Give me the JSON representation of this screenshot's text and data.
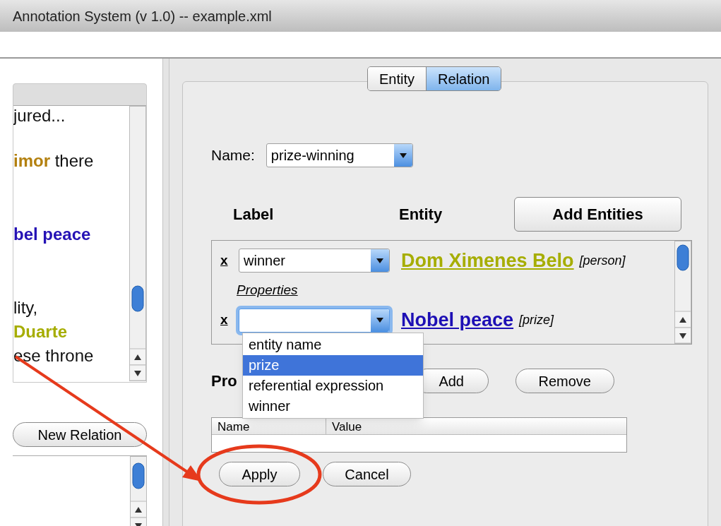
{
  "window": {
    "title": "Annotation System (v 1.0) -- example.xml"
  },
  "document_text": {
    "lines": [
      [
        {
          "text": "jured..."
        }
      ],
      [
        {
          "text": "imor",
          "color": "#b3800f"
        },
        {
          "text": " there"
        }
      ],
      [
        {
          "text": "bel peace",
          "color": "#2512b5"
        }
      ],
      [
        {
          "text": "lity,"
        }
      ],
      [
        {
          "text": "Duarte",
          "color": "#a6ad00"
        }
      ],
      [
        {
          "text": "ese throne"
        }
      ]
    ]
  },
  "new_relation_button": "New Relation",
  "tabs": [
    {
      "label": "Entity",
      "selected": false
    },
    {
      "label": "Relation",
      "selected": true
    }
  ],
  "relation_name": {
    "label": "Name:",
    "value": "prize-winning"
  },
  "entities": {
    "columns": [
      "Label",
      "Entity"
    ],
    "add_button": "Add Entities",
    "rows": [
      {
        "remove": "x",
        "label_value": "winner",
        "entity": "Dom Ximenes Belo",
        "type": "[person]",
        "color": "#a6ad00",
        "focused": false,
        "properties_link": "Properties"
      },
      {
        "remove": "x",
        "entity": "Nobel peace",
        "type": "[prize]",
        "color": "#1d0fb5",
        "focused": true
      }
    ]
  },
  "dropdown": {
    "options": [
      {
        "label": "entity name",
        "selected": false
      },
      {
        "label": "prize",
        "selected": true
      },
      {
        "label": "referential expression",
        "selected": false
      },
      {
        "label": "winner",
        "selected": false
      }
    ]
  },
  "properties": {
    "label": "Pro",
    "buttons": [
      "Add",
      "Remove"
    ],
    "table": {
      "columns": [
        "Name",
        "Value"
      ]
    }
  },
  "buttons": [
    "Apply",
    "Cancel"
  ]
}
